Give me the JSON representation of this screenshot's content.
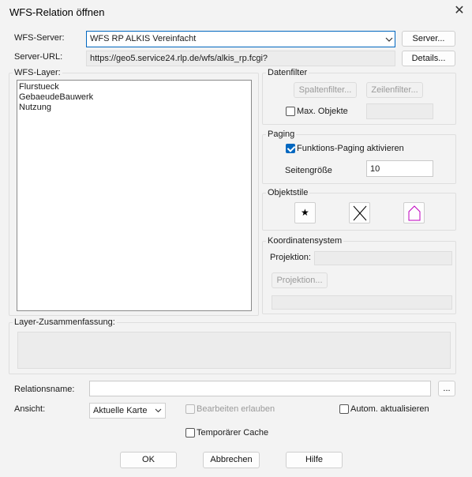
{
  "window": {
    "title": "WFS-Relation öffnen",
    "close_glyph": "✕"
  },
  "server": {
    "label": "WFS-Server:",
    "selected": "WFS RP ALKIS Vereinfacht",
    "server_button": "Server...",
    "url_label": "Server-URL:",
    "url_value": "https://geo5.service24.rlp.de/wfs/alkis_rp.fcgi?",
    "details_button": "Details..."
  },
  "layers": {
    "label": "WFS-Layer:",
    "items": [
      "Flurstueck",
      "GebaeudeBauwerk",
      "Nutzung"
    ]
  },
  "datenfilter": {
    "title": "Datenfilter",
    "spaltenfilter": "Spaltenfilter...",
    "zeilenfilter": "Zeilenfilter...",
    "max_objekte": "Max. Objekte"
  },
  "paging": {
    "title": "Paging",
    "funktions_paging": "Funktions-Paging aktivieren",
    "funktions_paging_checked": true,
    "seitengroesse_label": "Seitengröße",
    "seitengroesse_value": "10"
  },
  "objektstile": {
    "title": "Objektstile",
    "point_glyph": "★"
  },
  "koordinatensystem": {
    "title": "Koordinatensystem",
    "projektion_label": "Projektion:",
    "projektion_button": "Projektion..."
  },
  "summary": {
    "label": "Layer-Zusammenfassung:"
  },
  "bottom": {
    "relationsname_label": "Relationsname:",
    "relationsname_button": "...",
    "ansicht_label": "Ansicht:",
    "ansicht_value": "Aktuelle Karte",
    "bearbeiten": "Bearbeiten erlauben",
    "autom": "Autom. aktualisieren",
    "temp_cache": "Temporärer Cache",
    "ok": "OK",
    "abbrechen": "Abbrechen",
    "hilfe": "Hilfe"
  },
  "colors": {
    "accent": "#0067c0",
    "style_pink": "#c000c0"
  }
}
